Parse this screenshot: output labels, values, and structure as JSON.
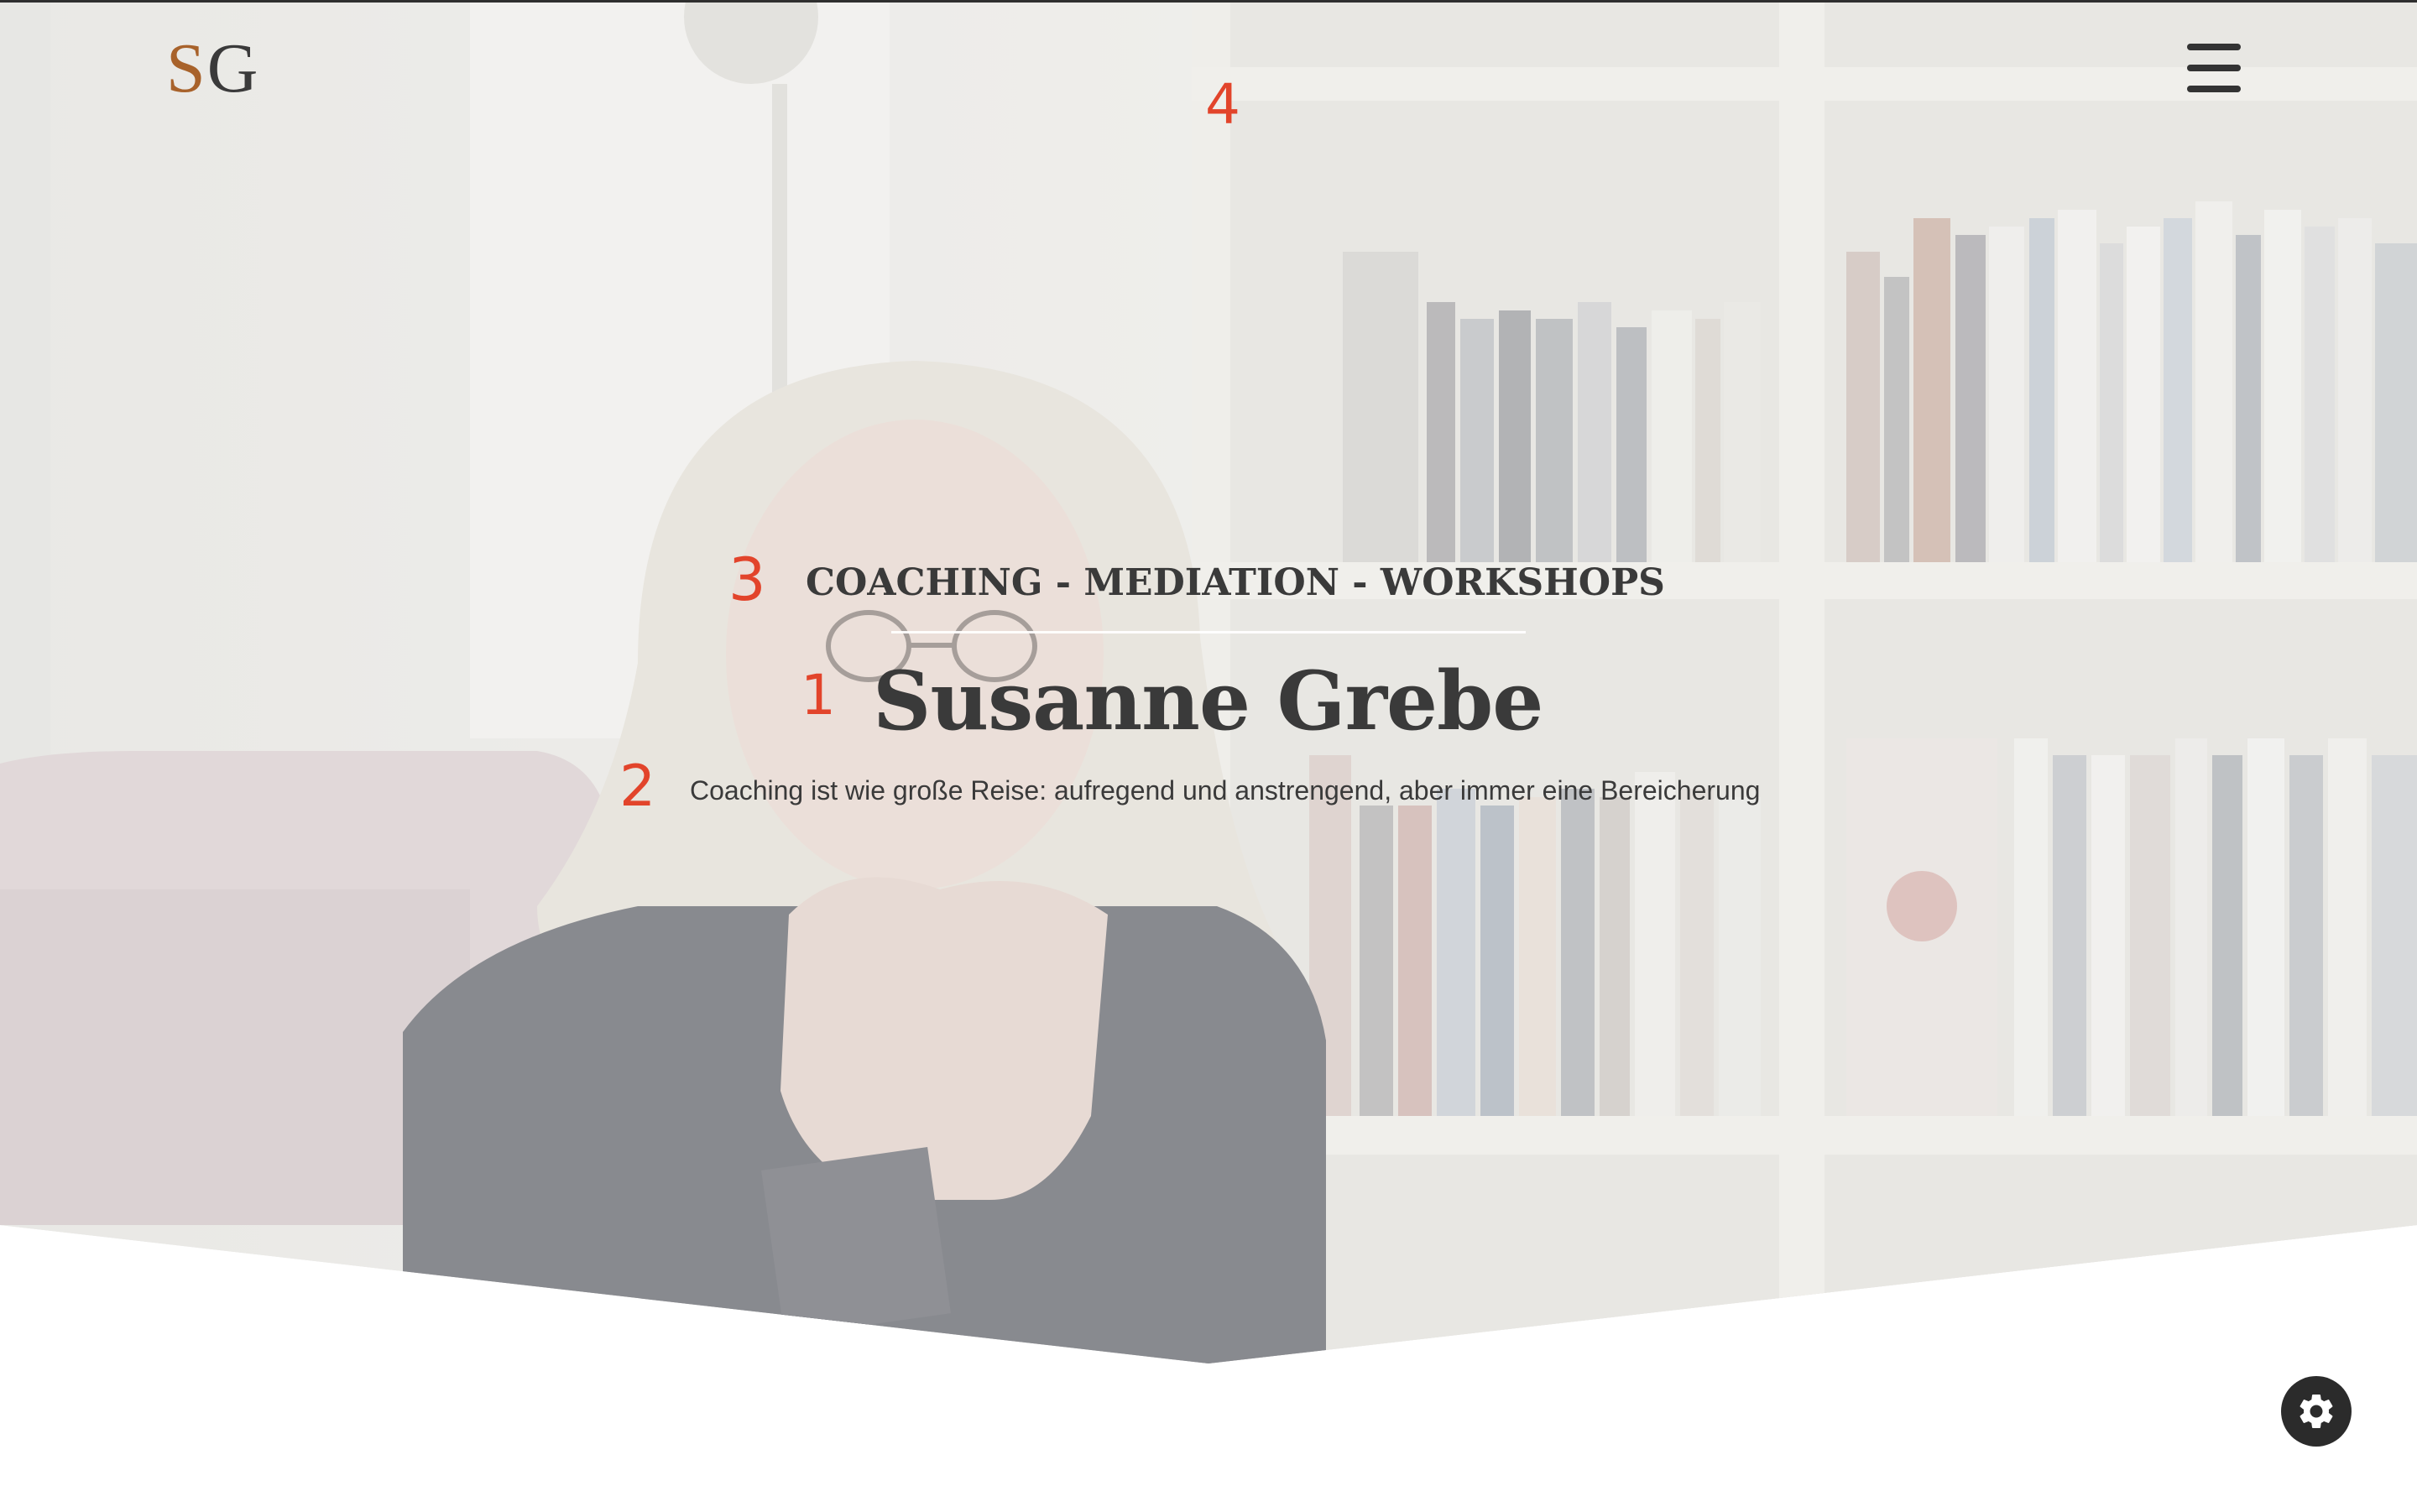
{
  "header": {
    "logo": {
      "letter_s": "S",
      "letter_g": "G"
    },
    "menu_icon": "hamburger-menu-icon"
  },
  "hero": {
    "tagline": "COACHING - MEDIATION - WORKSHOPS",
    "title": "Susanne Grebe",
    "subtitle": "Coaching ist wie große Reise: aufregend und anstrengend, aber immer eine Bereicherung"
  },
  "markers": {
    "m1": "1",
    "m2": "2",
    "m3": "3",
    "m4": "4"
  },
  "settings": {
    "icon": "gear-icon"
  },
  "colors": {
    "logo_s": "#a8622b",
    "text": "#3a3a3a",
    "marker": "#e2442b",
    "fab": "#2b2b2b"
  }
}
